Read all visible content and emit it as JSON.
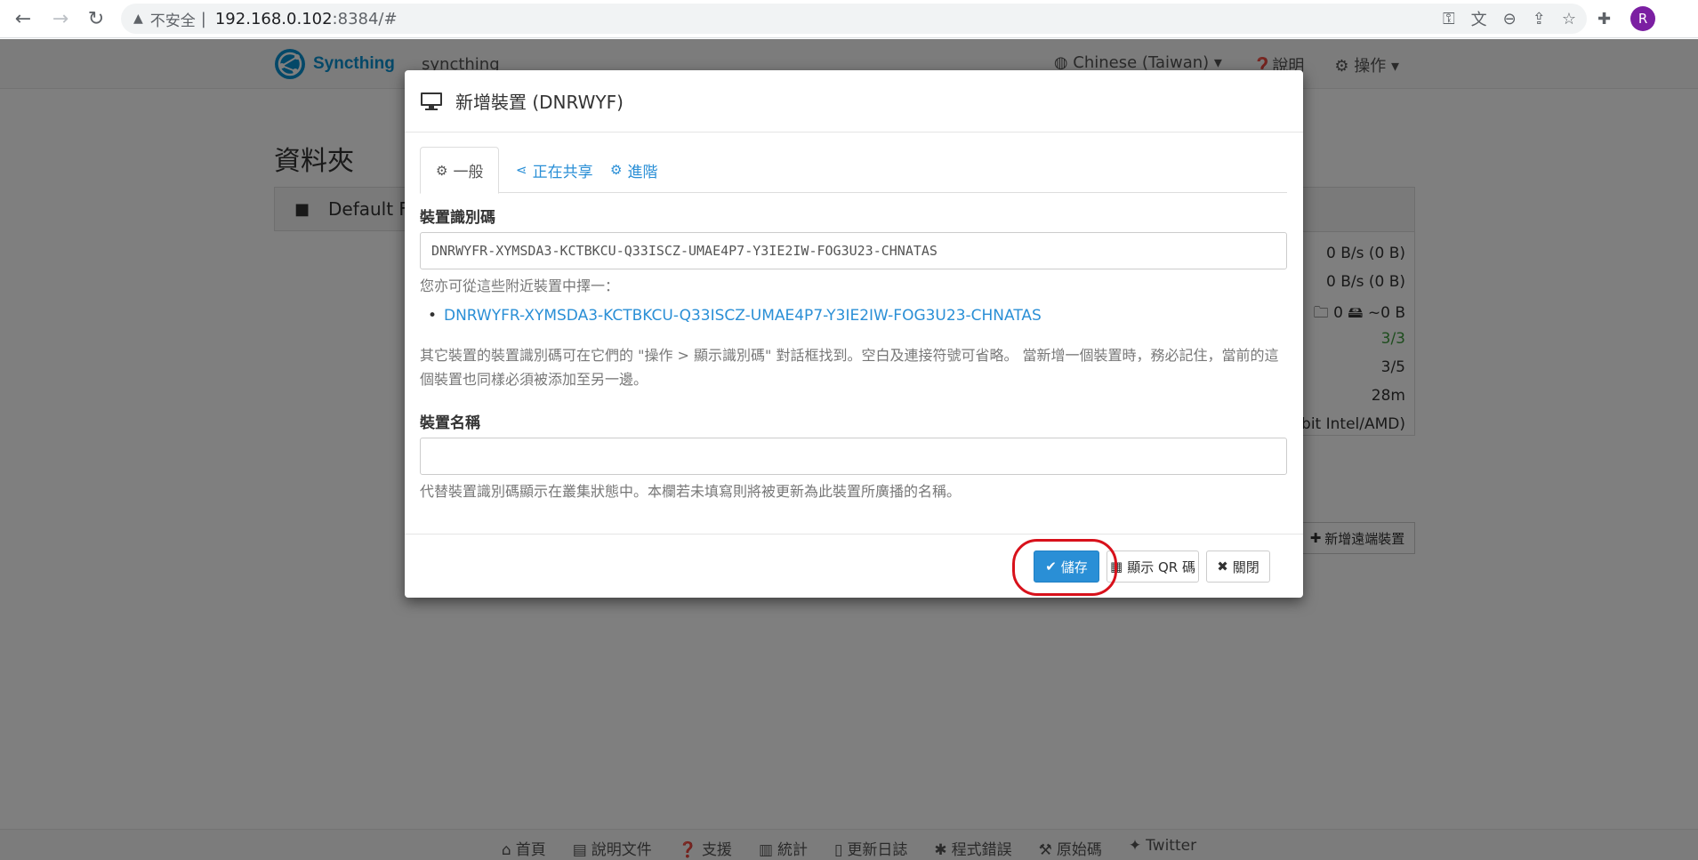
{
  "browser": {
    "insecure_label": "不安全",
    "url_host": "192.168.0.102",
    "url_rest": ":8384/#",
    "avatar_letter": "R"
  },
  "app": {
    "brand": "Syncthing",
    "device_name": "syncthing",
    "nav": {
      "language": "Chinese (Taiwan)",
      "help": "說明",
      "actions": "操作"
    },
    "folders_title": "資料夾",
    "folder_name": "Default F",
    "stats": [
      {
        "text": "0 B/s (0 B)",
        "top": 0
      },
      {
        "text": "0 B/s (0 B)"
      },
      {
        "text": "🗀 0   🖴 ~0 B"
      },
      {
        "text": "3/3"
      },
      {
        "text": "3/5"
      },
      {
        "text": "28m"
      },
      {
        "text": "bit Intel/AMD)"
      }
    ],
    "add_remote": "新增遠端裝置",
    "footer": [
      "首頁",
      "說明文件",
      "支援",
      "統計",
      "更新日誌",
      "程式錯誤",
      "原始碼",
      "Twitter"
    ]
  },
  "modal": {
    "title": "新增裝置 (DNRWYF)",
    "tabs": {
      "general": "一般",
      "sharing": "正在共享",
      "advanced": "進階"
    },
    "device_id_label": "裝置識別碼",
    "device_id_value": "DNRWYFR-XYMSDA3-KCTBKCU-Q33ISCZ-UMAE4P7-Y3IE2IW-FOG3U23-CHNATAS",
    "nearby_hint": "您亦可從這些附近裝置中擇一：",
    "nearby_device": "DNRWYFR-XYMSDA3-KCTBKCU-Q33ISCZ-UMAE4P7-Y3IE2IW-FOG3U23-CHNATAS",
    "id_help": "其它裝置的裝置識別碼可在它們的 \"操作 > 顯示識別碼\" 對話框找到。空白及連接符號可省略。 當新增一個裝置時，務必記住，當前的這個裝置也同樣必須被添加至另一邊。",
    "name_label": "裝置名稱",
    "name_value": "",
    "name_help": "代替裝置識別碼顯示在叢集狀態中。本欄若未填寫則將被更新為此裝置所廣播的名稱。",
    "buttons": {
      "save": "儲存",
      "qr": "顯示 QR 碼",
      "close": "關閉"
    }
  },
  "colors": {
    "accent": "#2a8fd6",
    "highlight": "#d8111b"
  }
}
